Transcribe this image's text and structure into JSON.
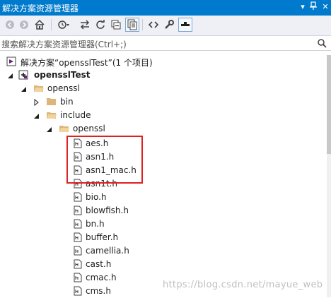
{
  "window": {
    "title": "解决方案资源管理器"
  },
  "toolbar": {
    "buttons": [
      "back-icon",
      "forward-icon",
      "home-icon",
      "history-icon",
      "sync-icon",
      "refresh-icon",
      "collapse-all-icon",
      "show-all-files-icon",
      "code-view-icon",
      "properties-icon",
      "preview-icon"
    ]
  },
  "search": {
    "placeholder": "搜索解决方案资源管理器(Ctrl+;)"
  },
  "tree": {
    "solution_label": "解决方案“opensslTest”(1 个项目)",
    "project_label": "opensslTest",
    "folder_openssl": "openssl",
    "folder_bin": "bin",
    "folder_include": "include",
    "folder_openssl_inner": "openssl",
    "files": [
      "aes.h",
      "asn1.h",
      "asn1_mac.h",
      "asn1t.h",
      "bio.h",
      "blowfish.h",
      "bn.h",
      "buffer.h",
      "camellia.h",
      "cast.h",
      "cmac.h",
      "cms.h"
    ]
  },
  "watermark": "https://blog.csdn.net/mayue_web",
  "colors": {
    "titlebar": "#007acc",
    "highlight": "#e02020",
    "folder": "#dcb67a"
  }
}
